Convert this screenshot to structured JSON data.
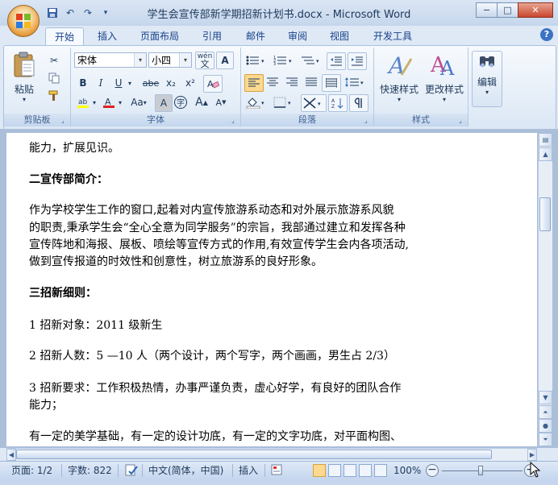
{
  "window": {
    "title": "学生会宣传部新学期招新计划书.docx - Microsoft Word",
    "controls": {
      "minimize": "−",
      "maximize": "□",
      "close": "✕"
    }
  },
  "quick_access": {
    "icons": [
      "save-icon",
      "undo-icon",
      "redo-icon",
      "customize-icon"
    ]
  },
  "tabs": [
    {
      "label": "开始",
      "active": true
    },
    {
      "label": "插入"
    },
    {
      "label": "页面布局"
    },
    {
      "label": "引用"
    },
    {
      "label": "邮件"
    },
    {
      "label": "审阅"
    },
    {
      "label": "视图"
    },
    {
      "label": "开发工具"
    }
  ],
  "ribbon": {
    "clipboard": {
      "label": "剪贴板",
      "paste_label": "粘贴"
    },
    "font": {
      "label": "字体",
      "font_name": "宋体",
      "font_size": "小四",
      "buttons": [
        "B",
        "I",
        "U",
        "abe",
        "x₂",
        "x²",
        "A",
        "Aa",
        "A",
        "字",
        "A",
        "A"
      ],
      "wen_label": "wén"
    },
    "paragraph": {
      "label": "段落"
    },
    "styles": {
      "label": "样式",
      "quick_styles": "快速样式",
      "change_styles": "更改样式"
    },
    "editing": {
      "label": "编辑"
    }
  },
  "document": {
    "lines": [
      {
        "text": "能力，扩展见识。",
        "bold": false
      },
      {
        "text": "二宣传部简介：",
        "bold": true
      },
      {
        "text": "      作为学校学生工作的窗口,起着对内宣传旅游系动态和对外展示旅游系风貌",
        "bold": false
      },
      {
        "text": "的职责,秉承学生会“全心全意为同学服务”的宗旨，我部通过建立和发挥各种",
        "bold": false
      },
      {
        "text": "宣传阵地和海报、展板、喷绘等宣传方式的作用,有效宣传学生会内各项活动,",
        "bold": false
      },
      {
        "text": "做到宣传报道的时效性和创意性，树立旅游系的良好形象。",
        "bold": false
      },
      {
        "text": "三招新细则：",
        "bold": true
      },
      {
        "text": "    1 招新对象：2011 级新生",
        "bold": false
      },
      {
        "text": "    2 招新人数：5 —10 人（两个设计，两个写字，两个画画，男生占 2/3）",
        "bold": false
      },
      {
        "text": "    3 招新要求：工作积极热情，办事严谨负责，虚心好学，有良好的团队合作",
        "bold": false
      },
      {
        "text": "能力；",
        "bold": false
      },
      {
        "text": "      有一定的美学基础，有一定的设计功底，有一定的文字功底，对平面构图、",
        "bold": false
      }
    ]
  },
  "status": {
    "page": "页面: 1/2",
    "words": "字数: 822",
    "language": "中文(简体，中国)",
    "insert_mode": "插入",
    "zoom": "100%"
  }
}
